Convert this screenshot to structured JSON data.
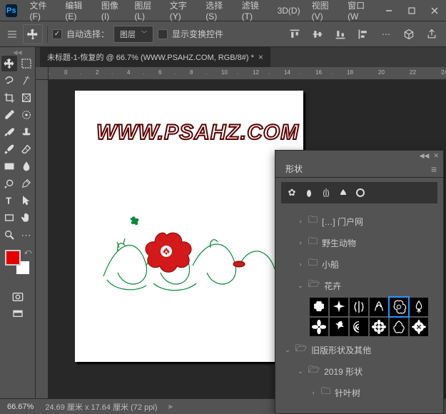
{
  "menu": [
    "文件(F)",
    "编辑(E)",
    "图像(I)",
    "图层(L)",
    "文字(Y)",
    "选择(S)",
    "滤镜(T)",
    "3D(D)",
    "视图(V)",
    "窗口(W"
  ],
  "optbar": {
    "autoSelectLabel": "自动选择：",
    "dropdown": "图层",
    "showTransformLabel": "显示变换控件"
  },
  "docTab": "未标题-1-恢复的 @ 66.7% (WWW.PSAHZ.COM, RGB/8#) *",
  "canvasText": "WWW.PSAHZ.COM",
  "rulerH": [
    ".",
    "0",
    ".",
    "2",
    ".",
    "4",
    ".",
    "6",
    ".",
    "8",
    ".",
    "10",
    ".",
    "12",
    ".",
    "14",
    ".",
    "16",
    ".",
    "18",
    "",
    "20",
    "",
    "22",
    "",
    "24",
    ""
  ],
  "panel": {
    "title": "形状"
  },
  "tree": {
    "cut": "[…] 门户网",
    "wild": "野生动物",
    "boat": "小船",
    "flower": "花卉",
    "legacy": "旧版形状及其他",
    "y2019": "2019 形状",
    "conifer": "针叶树"
  },
  "status": {
    "zoom": "66.67%",
    "dim": "24.69 厘米 x 17.64 厘米 (72 ppi)"
  },
  "swatches": {
    "fg": "#e60000",
    "bg": "#ffffff"
  }
}
